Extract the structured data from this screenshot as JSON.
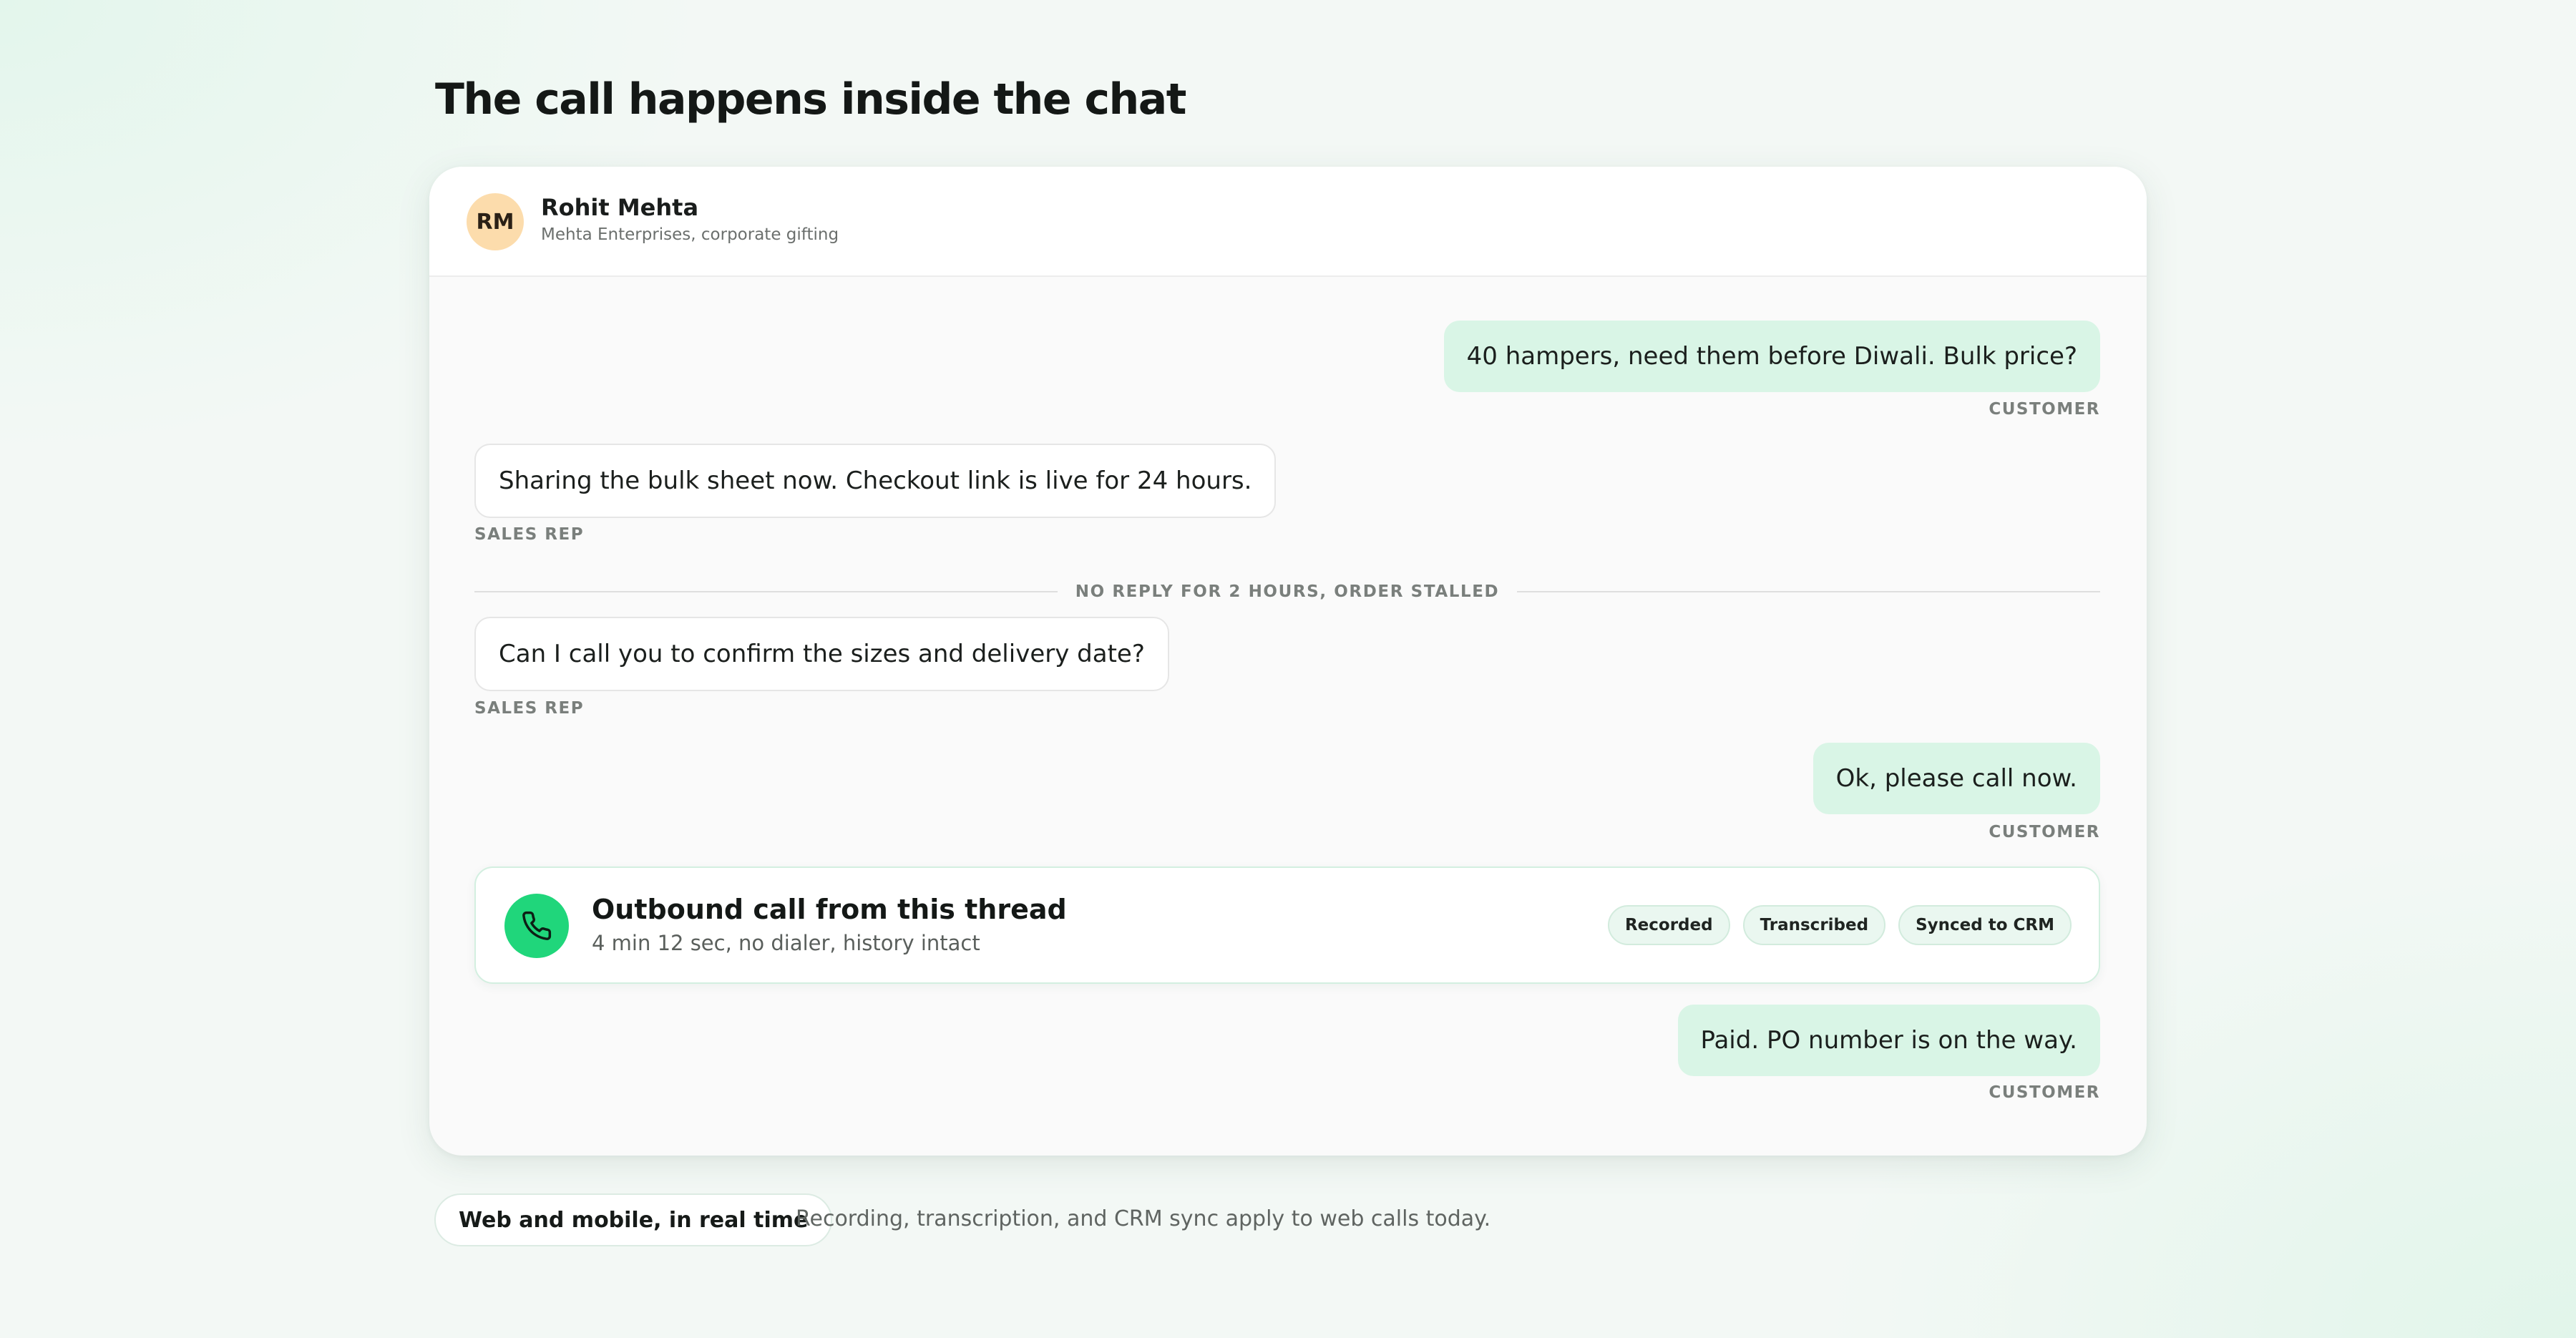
{
  "page": {
    "title": "The call happens inside the chat"
  },
  "contact": {
    "initials": "RM",
    "name": "Rohit Mehta",
    "subtitle": "Mehta Enterprises, corporate gifting"
  },
  "messages": [
    {
      "text": "40 hampers, need them before Diwali. Bulk price?",
      "sender": "CUSTOMER"
    },
    {
      "text": "Sharing the bulk sheet now. Checkout link is live for 24 hours.",
      "sender": "SALES REP"
    },
    {
      "text": "Can I call you to confirm the sizes and delivery date?",
      "sender": "SALES REP"
    },
    {
      "text": "Ok, please call now.",
      "sender": "CUSTOMER"
    },
    {
      "text": "Paid. PO number is on the way.",
      "sender": "CUSTOMER"
    }
  ],
  "divider": {
    "text": "NO REPLY FOR 2 HOURS, ORDER STALLED"
  },
  "call": {
    "icon": "phone-icon",
    "title": "Outbound call from this thread",
    "subtitle": "4 min 12 sec, no dialer, history intact",
    "tags": [
      "Recorded",
      "Transcribed",
      "Synced to CRM"
    ]
  },
  "footer": {
    "pill": "Web and mobile, in real time",
    "note": "Recording, transcription, and CRM sync apply to web calls today."
  },
  "colors": {
    "accent": "#20d67b",
    "customer_bubble": "#d9f5e6",
    "avatar_bg": "#fcdcac"
  }
}
